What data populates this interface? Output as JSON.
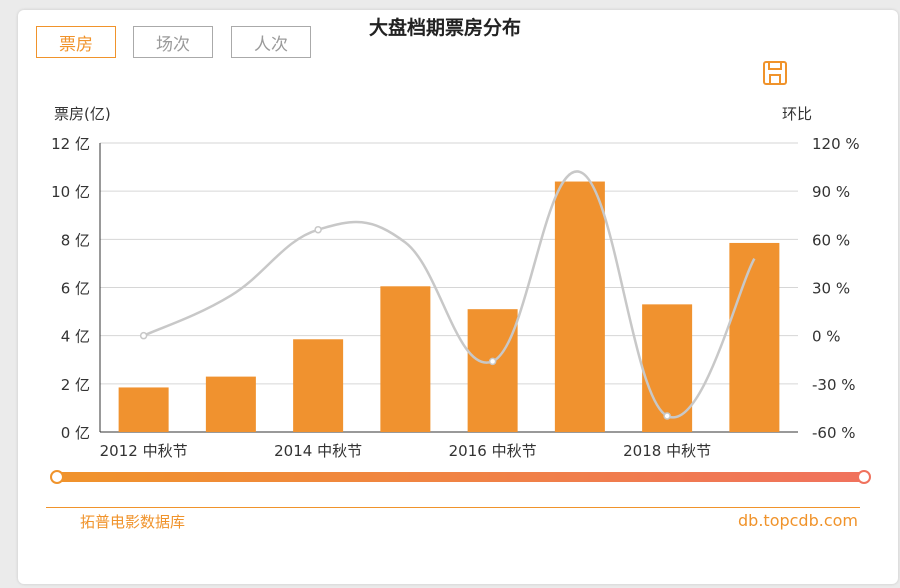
{
  "tabs": [
    {
      "label": "票房",
      "active": true
    },
    {
      "label": "场次",
      "active": false
    },
    {
      "label": "人次",
      "active": false
    }
  ],
  "save_icon": "save-icon",
  "colors": {
    "accent": "#f0932b",
    "bar": "#f0922f",
    "line": "#c8c8c8",
    "slider_start": "#f0932b",
    "slider_end": "#f0725d"
  },
  "footer": {
    "source": "拓普电影数据库",
    "site": "db.topcdb.com"
  },
  "chart_data": {
    "type": "bar",
    "title": "大盘档期票房分布",
    "ylabel_left": "票房(亿)",
    "ylabel_right": "环比",
    "x_tick_labels": [
      "2012 中秋节",
      "2014 中秋节",
      "2016 中秋节",
      "2018 中秋节"
    ],
    "x_tick_indices": [
      0,
      2,
      4,
      6
    ],
    "y_left_ticks": [
      "0 亿",
      "2 亿",
      "4 亿",
      "6 亿",
      "8 亿",
      "10 亿",
      "12 亿"
    ],
    "y_right_ticks": [
      "-60 %",
      "-30 %",
      "0 %",
      "30 %",
      "60 %",
      "90 %",
      "120 %"
    ],
    "ylim_left": [
      0,
      12
    ],
    "ylim_right": [
      -60,
      120
    ],
    "grid": true,
    "series": [
      {
        "type": "bar",
        "values": [
          1.85,
          2.3,
          3.85,
          6.05,
          5.1,
          10.4,
          5.3,
          7.85
        ]
      },
      {
        "type": "line",
        "axis": "right",
        "values": [
          0,
          25,
          66,
          58,
          -16,
          102,
          -50,
          48
        ]
      }
    ],
    "slider": {
      "start": 0,
      "end": 1
    }
  }
}
